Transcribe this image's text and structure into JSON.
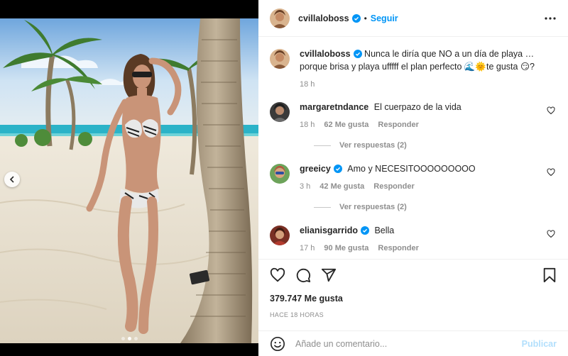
{
  "post": {
    "author": "cvillaloboss",
    "separator": "•",
    "follow_label": "Seguir",
    "caption": "Nunca le diría que NO a un día de playa …porque brisa y playa ufffff el plan perfecto 🌊🌞te gusta 😏?",
    "caption_time": "18 h",
    "likes": "379.747 Me gusta",
    "time_ago": "HACE 18 HORAS"
  },
  "comments": [
    {
      "user": "margaretndance",
      "verified": false,
      "text": "El cuerpazo de la vida",
      "time": "18 h",
      "likes": "62 Me gusta",
      "reply_label": "Responder",
      "view_replies": "Ver respuestas (2)"
    },
    {
      "user": "greeicy",
      "verified": true,
      "text": "Amo y NECESITOOOOOOOOO",
      "time": "3 h",
      "likes": "42 Me gusta",
      "reply_label": "Responder",
      "view_replies": "Ver respuestas (2)"
    },
    {
      "user": "elianisgarrido",
      "verified": true,
      "text": "Bella",
      "time": "17 h",
      "likes": "90 Me gusta",
      "reply_label": "Responder"
    }
  ],
  "comment_box": {
    "placeholder": "Añade un comentario...",
    "publish_label": "Publicar"
  },
  "colors": {
    "accent": "#0095f6",
    "publish_disabled": "#b2dffc",
    "secondary_text": "#8e8e8e"
  },
  "icons": [
    "chevron-left-icon",
    "more-options-icon",
    "verified-icon",
    "heart-icon",
    "comment-icon",
    "share-icon",
    "bookmark-icon",
    "emoji-icon"
  ]
}
